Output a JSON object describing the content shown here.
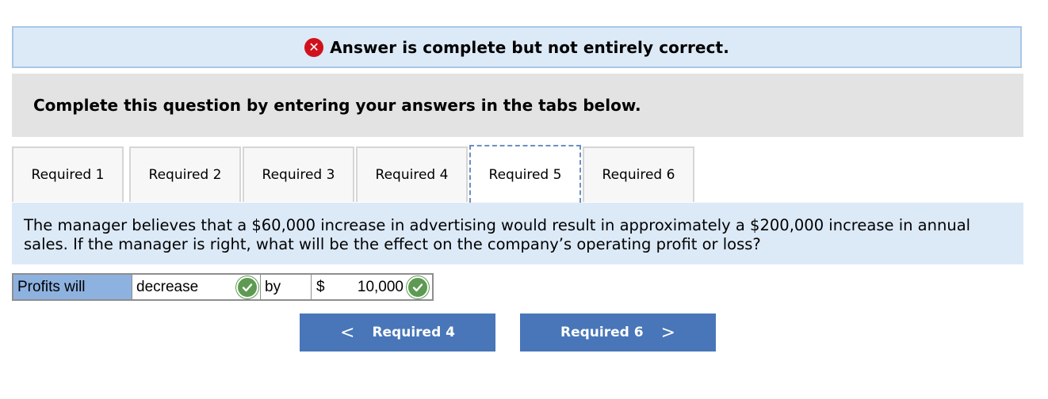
{
  "banner": {
    "status_icon": "x-circle-icon",
    "message": "Answer is complete but not entirely correct."
  },
  "instruction": "Complete this question by entering your answers in the tabs below.",
  "tabs": [
    {
      "label": "Required 1",
      "active": false
    },
    {
      "label": "Required 2",
      "active": false
    },
    {
      "label": "Required 3",
      "active": false
    },
    {
      "label": "Required 4",
      "active": false
    },
    {
      "label": "Required 5",
      "active": true
    },
    {
      "label": "Required 6",
      "active": false
    }
  ],
  "question": "The manager believes that a $60,000 increase in advertising would result in approximately a $200,000 increase in annual sales. If the manager is right, what will be the effect on the company’s operating profit or loss?",
  "answer_row": {
    "label": "Profits will",
    "selected_value": "decrease",
    "connector": "by",
    "currency": "$",
    "amount": "10,000"
  },
  "navigation": {
    "prev_label": "Required 4",
    "prev_chevron": "<",
    "next_label": "Required 6",
    "next_chevron": ">"
  },
  "colors": {
    "banner_bg": "#dce9f7",
    "error_red": "#d0111b",
    "correct_green": "#5e9a52",
    "button_blue": "#4876b8",
    "label_blue": "#8eb2e0"
  }
}
